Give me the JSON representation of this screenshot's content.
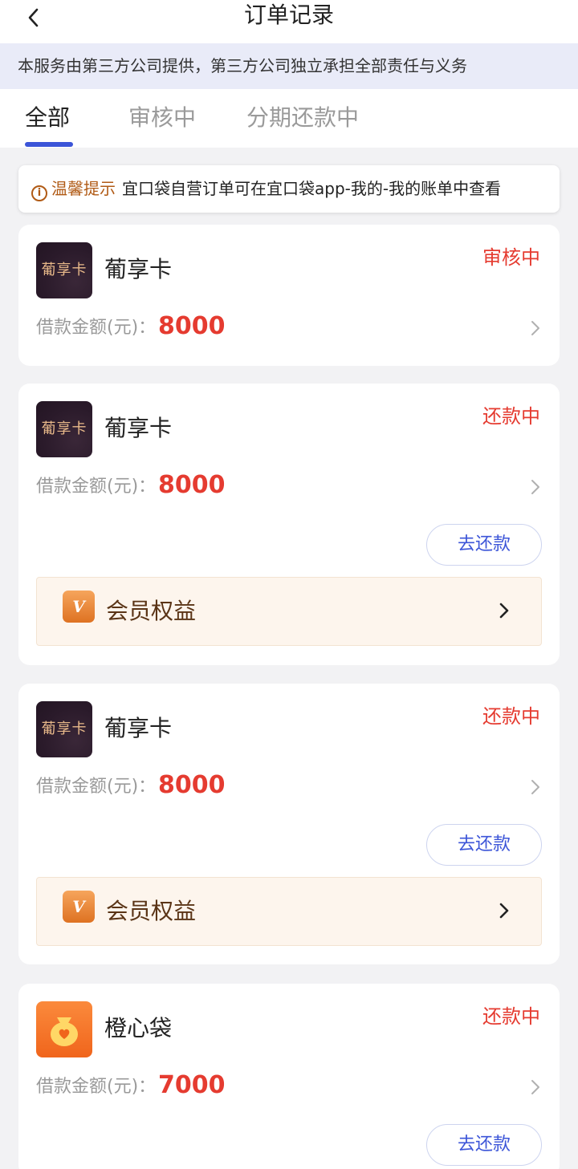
{
  "header": {
    "title": "订单记录",
    "back_icon": "chevron-left-icon"
  },
  "notice": "本服务由第三方公司提供，第三方公司独立承担全部责任与义务",
  "tabs": [
    {
      "label": "全部",
      "active": true
    },
    {
      "label": "审核中",
      "active": false
    },
    {
      "label": "分期还款中",
      "active": false
    }
  ],
  "tip": {
    "icon": "info-icon",
    "label": "温馨提示",
    "text": "宜口袋自营订单可在宜口袋app-我的-我的账单中查看"
  },
  "colors": {
    "accent": "#3c55d8",
    "status_red": "#e53b30",
    "tip_brown": "#b05a15",
    "vip_brown": "#5a3416"
  },
  "orders": [
    {
      "product": "葡享卡",
      "logo_text": "葡享卡",
      "status": "审核中",
      "amount_label": "借款金额(元)：",
      "amount": "8000"
    },
    {
      "product": "葡享卡",
      "logo_text": "葡享卡",
      "status": "还款中",
      "amount_label": "借款金额(元)：",
      "amount": "8000",
      "pay_button": "去还款",
      "vip": {
        "badge": "V",
        "label": "会员权益"
      }
    },
    {
      "product": "葡享卡",
      "logo_text": "葡享卡",
      "status": "还款中",
      "amount_label": "借款金额(元)：",
      "amount": "8000",
      "pay_button": "去还款",
      "vip": {
        "badge": "V",
        "label": "会员权益"
      }
    },
    {
      "product": "橙心袋",
      "logo_icon": "money-bag-heart-icon",
      "status": "还款中",
      "amount_label": "借款金额(元)：",
      "amount": "7000",
      "pay_button": "去还款"
    }
  ]
}
